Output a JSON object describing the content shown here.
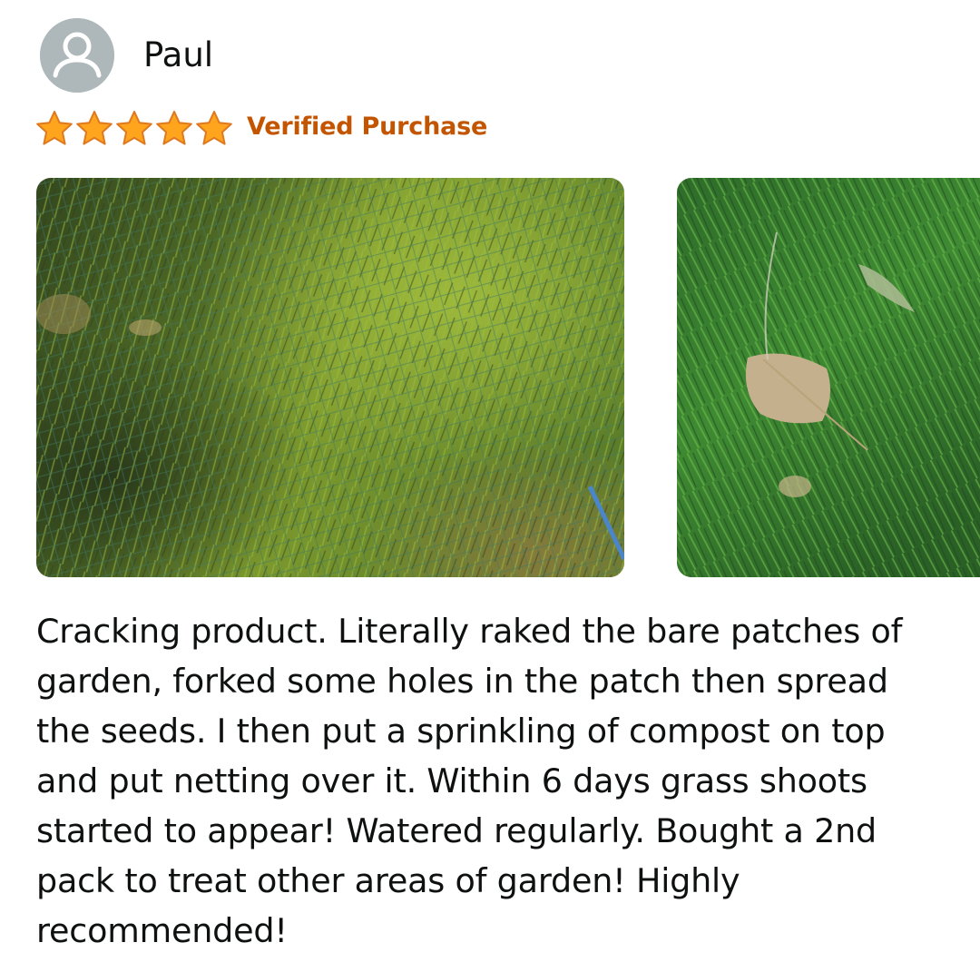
{
  "reviewer": {
    "name": "Paul",
    "avatar_icon": "user-silhouette-icon"
  },
  "rating": {
    "value": 5,
    "max": 5,
    "star_color": "#ffa41c",
    "star_outline": "#de7921",
    "star_icon": "star-icon"
  },
  "badge": {
    "label": "Verified Purchase",
    "color": "#c45500"
  },
  "photos": [
    {
      "subject": "grass patch with green netting"
    },
    {
      "subject": "grass with a dry leaf"
    }
  ],
  "review": {
    "text": "Cracking product. Literally raked the bare patches of garden, forked some holes in the patch then spread the seeds. I then put a sprinkling of compost on top and put netting over it. Within 6 days grass shoots started to appear! Watered regularly. Bought a 2nd pack to treat other areas of garden! Highly recommended!"
  }
}
